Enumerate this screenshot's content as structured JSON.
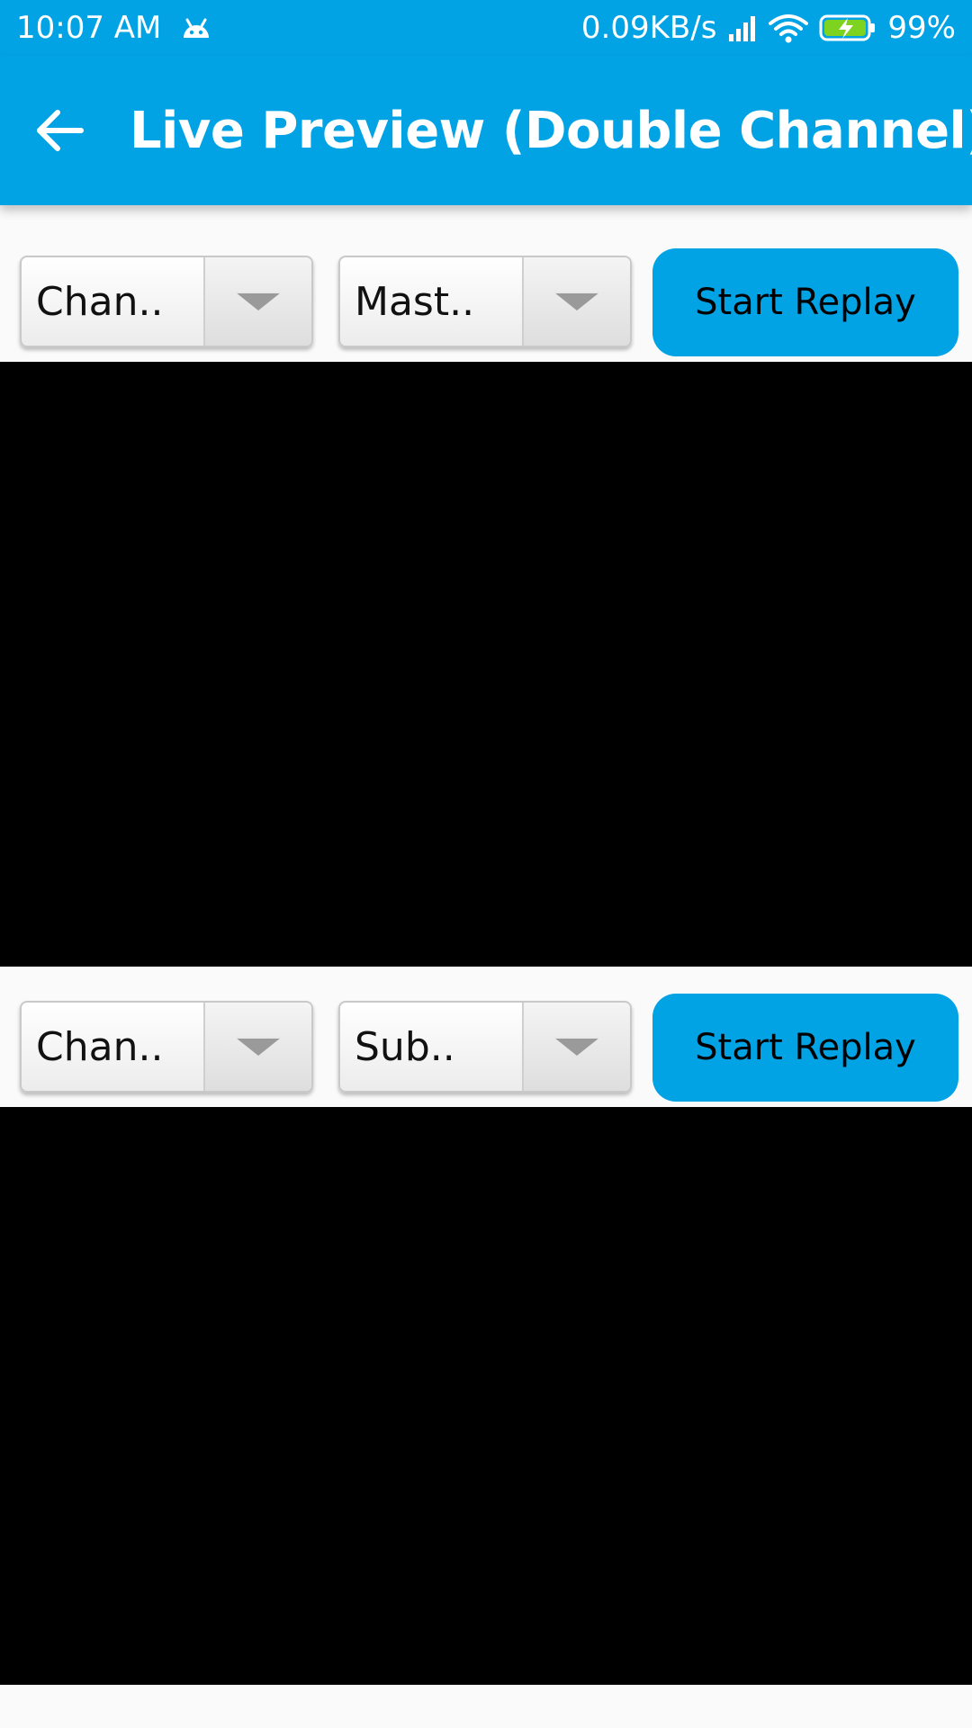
{
  "status_bar": {
    "time": "10:07  AM",
    "network_speed": "0.09KB/s",
    "battery": "99%",
    "icons": [
      "android-notification-icon",
      "signal-icon",
      "wifi-icon",
      "battery-charging-icon"
    ]
  },
  "app_bar": {
    "back_icon": "arrow-left-icon",
    "title": "Live Preview (Double Channel)"
  },
  "panels": [
    {
      "channel_spinner": "Chan..",
      "stream_spinner": "Mast..",
      "replay_label": "Start Replay"
    },
    {
      "channel_spinner": "Chan..",
      "stream_spinner": "Sub..",
      "replay_label": "Start Replay"
    }
  ],
  "colors": {
    "primary": "#02a3e5",
    "video_background": "#000000",
    "page_background": "#fafafa"
  }
}
